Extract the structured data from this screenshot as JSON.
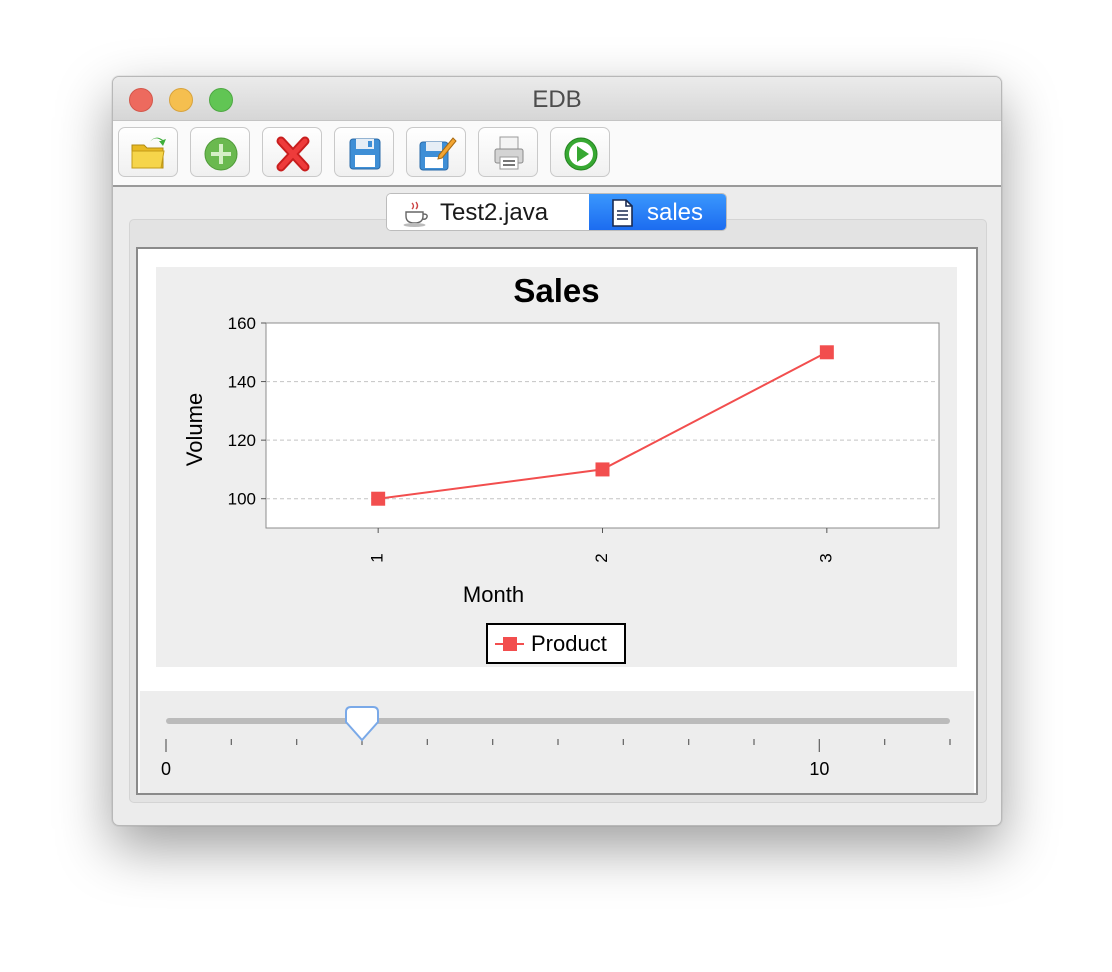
{
  "window": {
    "title": "EDB"
  },
  "toolbar": {
    "buttons": [
      {
        "name": "open",
        "icon": "open-folder-icon"
      },
      {
        "name": "add",
        "icon": "add-icon"
      },
      {
        "name": "delete",
        "icon": "delete-icon"
      },
      {
        "name": "save",
        "icon": "save-icon"
      },
      {
        "name": "save-as",
        "icon": "save-edit-icon"
      },
      {
        "name": "print",
        "icon": "print-icon"
      },
      {
        "name": "run",
        "icon": "run-icon"
      }
    ]
  },
  "tabs": [
    {
      "label": "Test2.java",
      "icon": "java-cup-icon",
      "selected": false
    },
    {
      "label": "sales",
      "icon": "document-icon",
      "selected": true
    }
  ],
  "slider": {
    "value": 3,
    "min": 0,
    "max": 12,
    "labels": [
      "0",
      "10"
    ],
    "label_values": [
      0,
      10
    ]
  },
  "colors": {
    "series": "#f24e4e",
    "accent": "#2680f7"
  },
  "chart_data": {
    "type": "line",
    "title": "Sales",
    "xlabel": "Month",
    "ylabel": "Volume",
    "categories": [
      "1",
      "2",
      "3"
    ],
    "series": [
      {
        "name": "Product",
        "values": [
          100,
          110,
          150
        ]
      }
    ],
    "ylim": [
      90,
      160
    ],
    "yticks": [
      100,
      120,
      140,
      160
    ],
    "xlim": [
      0.5,
      3.5
    ],
    "grid": true,
    "legend": "bottom-center"
  }
}
